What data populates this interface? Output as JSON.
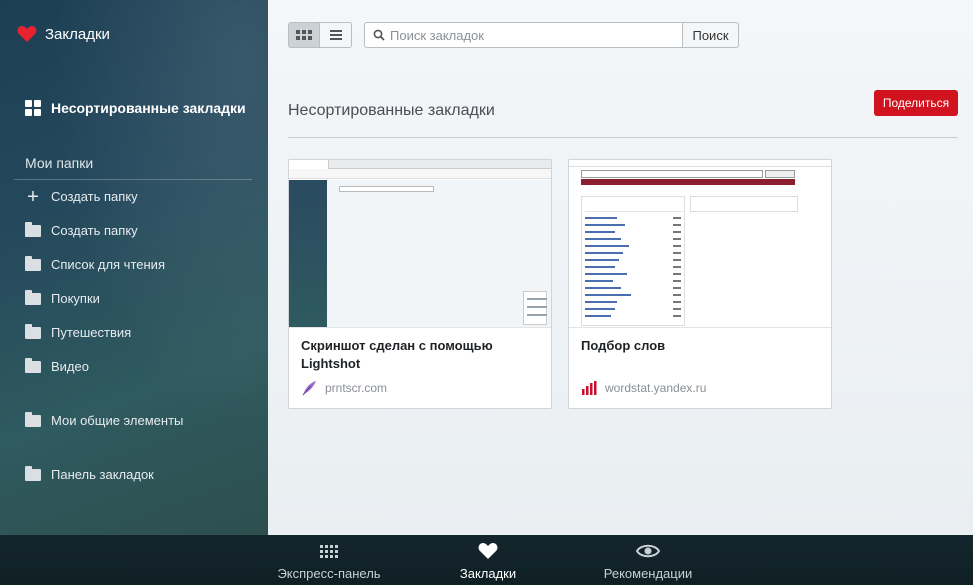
{
  "sidebar": {
    "title": "Закладки",
    "unsorted_label": "Несортированные закладки",
    "folders_title": "Мои папки",
    "items": [
      {
        "label": "Создать папку",
        "icon": "plus-icon"
      },
      {
        "label": "Создать папку",
        "icon": "folder-icon"
      },
      {
        "label": "Список для чтения",
        "icon": "folder-icon"
      },
      {
        "label": "Покупки",
        "icon": "folder-icon"
      },
      {
        "label": "Путешествия",
        "icon": "folder-icon"
      },
      {
        "label": "Видео",
        "icon": "folder-icon"
      },
      {
        "label": "Мои общие элементы",
        "icon": "folder-icon"
      },
      {
        "label": "Панель закладок",
        "icon": "folder-icon"
      }
    ]
  },
  "toolbar": {
    "search_placeholder": "Поиск закладок",
    "search_button": "Поиск"
  },
  "main": {
    "section_title": "Несортированные закладки",
    "share_button": "Поделиться",
    "cards": [
      {
        "title": "Скриншот сделан с помощью Lightshot",
        "site": "prntscr.com"
      },
      {
        "title": "Подбор слов",
        "site": "wordstat.yandex.ru"
      }
    ]
  },
  "bottom_nav": [
    {
      "label": "Экспресс-панель",
      "icon": "speed-dial-icon"
    },
    {
      "label": "Закладки",
      "icon": "heart-icon"
    },
    {
      "label": "Рекомендации",
      "icon": "eye-icon"
    }
  ],
  "colors": {
    "accent": "#d0131e",
    "brand_heart": "#e8222e"
  }
}
